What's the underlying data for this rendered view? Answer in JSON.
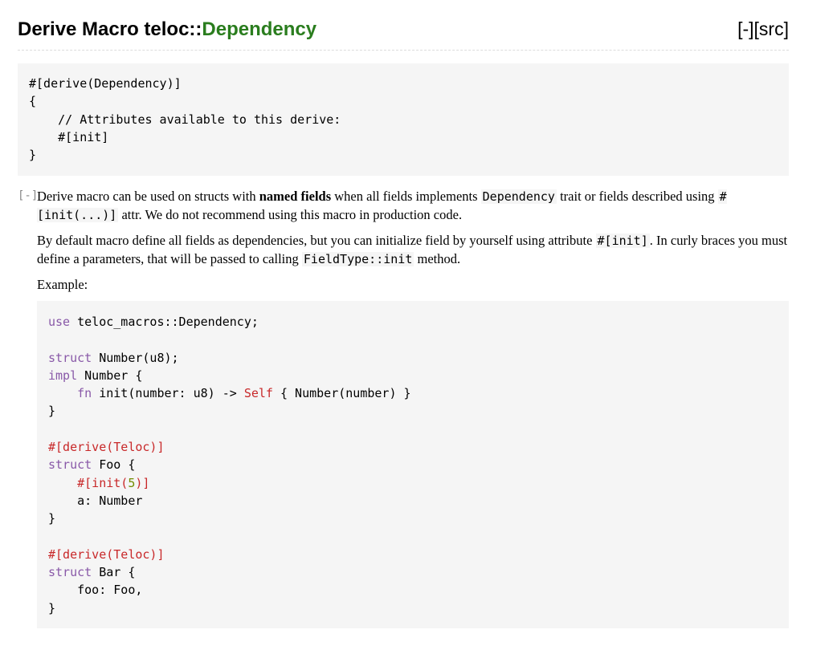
{
  "header": {
    "title_prefix": "Derive Macro teloc::",
    "title_name": "Dependency",
    "collapse_all_label": "[-]",
    "src_label": "[src]"
  },
  "declaration": {
    "line1": "#[derive(Dependency)]",
    "line2": "{",
    "line3": "    // Attributes available to this derive:",
    "line4": "    #[init]",
    "line5": "}"
  },
  "doc": {
    "toggle_label": "[-]",
    "p1": {
      "t1": "Derive macro can be used on structs with ",
      "bold": "named fields",
      "t2": " when all fields implements ",
      "code1": "Dependency",
      "t3": " trait or fields described using ",
      "code2": "#[init(...)]",
      "t4": " attr. We do not recommend using this macro in production code."
    },
    "p2": {
      "t1": "By default macro define all fields as dependencies, but you can initialize field by yourself using attribute ",
      "code1": "#[init]",
      "t2": ". In curly braces you must define a parameters, that will be passed to calling ",
      "code2": "FieldType::init",
      "t3": " method."
    },
    "p3": "Example:"
  },
  "example": {
    "l1_kw": "use",
    "l1_rest": " teloc_macros::Dependency;",
    "l3_kw": "struct",
    "l3_rest": " Number(u8);",
    "l4_kw": "impl",
    "l4_rest": " Number {",
    "l5_indent": "    ",
    "l5_kw": "fn",
    "l5_mid": " init(number: u8) -> ",
    "l5_self": "Self",
    "l5_rest": " { Number(number) }",
    "l6": "}",
    "l8_attr": "#[derive(Teloc)]",
    "l9_kw": "struct",
    "l9_rest": " Foo {",
    "l10_indent": "    ",
    "l10_attr1": "#[init(",
    "l10_num": "5",
    "l10_attr2": ")]",
    "l11": "    a: Number",
    "l12": "}",
    "l14_attr": "#[derive(Teloc)]",
    "l15_kw": "struct",
    "l15_rest": " Bar {",
    "l16": "    foo: Foo,",
    "l17": "}"
  }
}
